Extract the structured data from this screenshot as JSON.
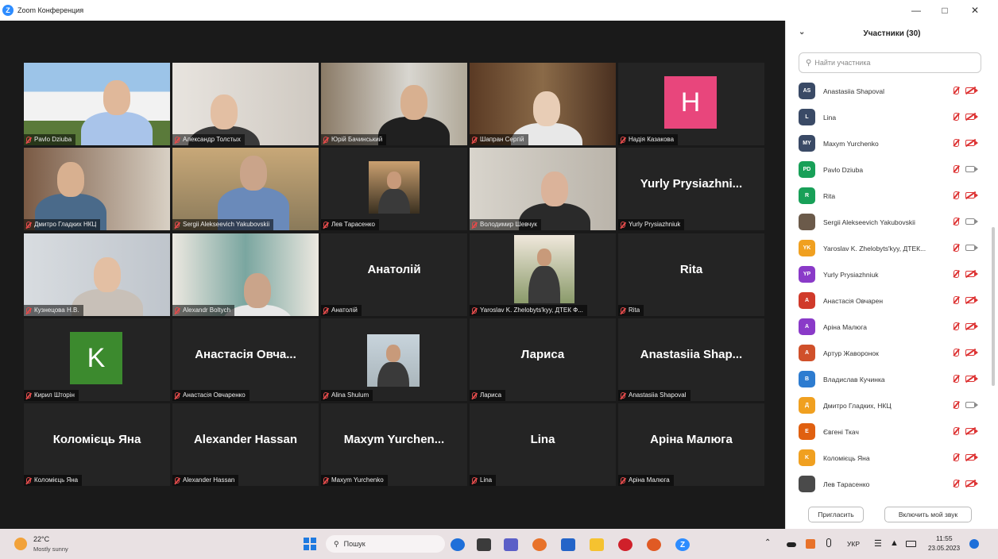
{
  "window": {
    "title": "Zoom Конференция",
    "minimize_icon": "minimize-icon",
    "maximize_icon": "maximize-icon",
    "close_icon": "close-icon"
  },
  "gallery": {
    "tiles": [
      {
        "name": "Pavlo Dziuba",
        "kind": "video"
      },
      {
        "name": "Александр Толстых",
        "kind": "video"
      },
      {
        "name": "Юрій Бачинський",
        "kind": "video"
      },
      {
        "name": "Шапран Сергій",
        "kind": "video"
      },
      {
        "name": "Надія Казакова",
        "kind": "letter",
        "letter": "H",
        "color": "#e8467c"
      },
      {
        "name": "Дмитро Гладких НКЦ",
        "kind": "video"
      },
      {
        "name": "Sergii Alekseevich Yakubovskii",
        "kind": "video"
      },
      {
        "name": "Лев Тарасенко",
        "kind": "thumb"
      },
      {
        "name": "Володимир Шевчук",
        "kind": "video",
        "active": true
      },
      {
        "name": "Yurly Prysiazhniuk",
        "kind": "text",
        "display": "Yurly Prysiazhni..."
      },
      {
        "name": "Кузнецова Н.В.",
        "kind": "video"
      },
      {
        "name": "Alexandr Boltych",
        "kind": "video"
      },
      {
        "name": "Анатолій",
        "kind": "text",
        "display": "Анатолій"
      },
      {
        "name": "Yaroslav K. Zhelobyts'kyy, ДТЕК Ф...",
        "kind": "thumb"
      },
      {
        "name": "Rita",
        "kind": "text",
        "display": "Rita"
      },
      {
        "name": "Кирил Шторін",
        "kind": "letter",
        "letter": "K",
        "color": "#3c8a2e"
      },
      {
        "name": "Анастасія Овчаренко",
        "kind": "text",
        "display": "Анастасія Овча..."
      },
      {
        "name": "Alina Shulum",
        "kind": "thumb"
      },
      {
        "name": "Лариса",
        "kind": "text",
        "display": "Лариса"
      },
      {
        "name": "Anastasiia Shapoval",
        "kind": "text",
        "display": "Anastasiia Shap..."
      },
      {
        "name": "Коломієць Яна",
        "kind": "text",
        "display": "Коломієць Яна"
      },
      {
        "name": "Alexander Hassan",
        "kind": "text",
        "display": "Alexander Hassan"
      },
      {
        "name": "Maxym Yurchenko",
        "kind": "text",
        "display": "Maxym Yurchen..."
      },
      {
        "name": "Lina",
        "kind": "text",
        "display": "Lina"
      },
      {
        "name": "Аріна Малюга",
        "kind": "text",
        "display": "Аріна Малюга"
      }
    ]
  },
  "panel": {
    "title": "Участники (30)",
    "search_placeholder": "Найти участника",
    "participants": [
      {
        "initials": "AS",
        "name": "Anastasiia Shapoval",
        "color": "#3a4a66",
        "video": false
      },
      {
        "initials": "L",
        "name": "Lina",
        "color": "#3a4a66",
        "video": false
      },
      {
        "initials": "MY",
        "name": "Maxym Yurchenko",
        "color": "#3a4a66",
        "video": false
      },
      {
        "initials": "PD",
        "name": "Pavlo Dziuba",
        "color": "#18a058",
        "video": true
      },
      {
        "initials": "R",
        "name": "Rita",
        "color": "#18a058",
        "video": false
      },
      {
        "initials": "",
        "name": "Sergii Alekseevich Yakubovskii",
        "color": "#6b5a4a",
        "video": true
      },
      {
        "initials": "YK",
        "name": "Yaroslav K. Zhelobyts'kyy, ДТЕК...",
        "color": "#f0a020",
        "video": true
      },
      {
        "initials": "YP",
        "name": "Yurly Prysiazhniuk",
        "color": "#8a3ac8",
        "video": false
      },
      {
        "initials": "A",
        "name": "Анастасія Овчарен",
        "color": "#d03a2a",
        "video": false
      },
      {
        "initials": "A",
        "name": "Аріна Малюга",
        "color": "#8a3ac8",
        "video": false
      },
      {
        "initials": "A",
        "name": "Артур Жаворонок",
        "color": "#d0502a",
        "video": false
      },
      {
        "initials": "B",
        "name": "Владислав Кучинка",
        "color": "#2d7cd0",
        "video": false
      },
      {
        "initials": "Д",
        "name": "Дмитро Гладких, НКЦ",
        "color": "#f0a020",
        "video": true
      },
      {
        "initials": "E",
        "name": "Євгені Ткач",
        "color": "#e06010",
        "video": false
      },
      {
        "initials": "K",
        "name": "Коломієць Яна",
        "color": "#f0a020",
        "video": false
      },
      {
        "initials": "",
        "name": "Лев Тарасенко",
        "color": "#4a4a4a",
        "video": false
      }
    ],
    "invite_label": "Пригласить",
    "unmute_label": "Включить мой звук"
  },
  "taskbar": {
    "weather_temp": "22°C",
    "weather_desc": "Mostly sunny",
    "search_label": "Пошук",
    "lang": "УКР",
    "time": "11:55",
    "date": "23.05.2023"
  }
}
